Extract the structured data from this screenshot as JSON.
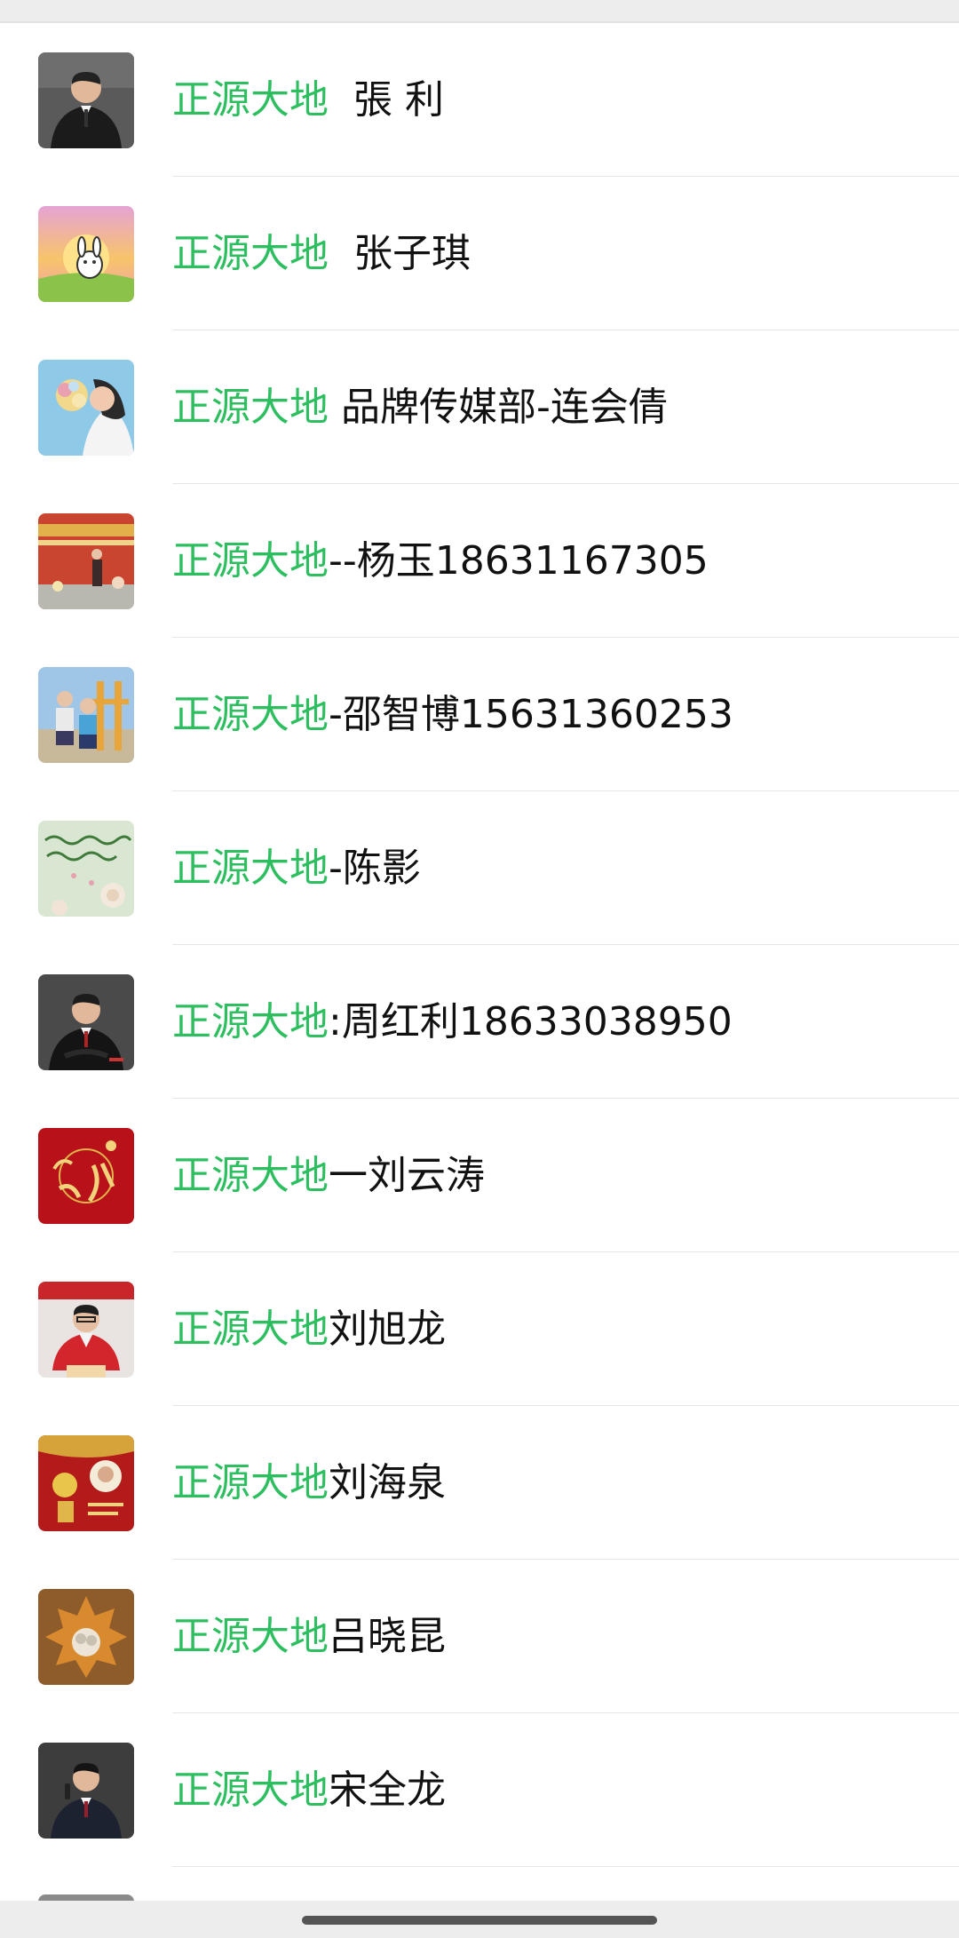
{
  "highlight_color": "#2dbf5f",
  "contacts": [
    {
      "highlight": "正源大地",
      "rest": "  張 利",
      "avatar_icon": "man-in-suit-photo"
    },
    {
      "highlight": "正源大地",
      "rest": "  张子琪",
      "avatar_icon": "cartoon-sunset-avatar"
    },
    {
      "highlight": "正源大地",
      "rest": " 品牌传媒部-连会倩",
      "avatar_icon": "woman-with-flowers-photo"
    },
    {
      "highlight": "正源大地",
      "rest": "--杨玉18631167305",
      "avatar_icon": "red-banner-photo"
    },
    {
      "highlight": "正源大地",
      "rest": "-邵智博15631360253",
      "avatar_icon": "children-playground-photo"
    },
    {
      "highlight": "正源大地",
      "rest": "-陈影",
      "avatar_icon": "flower-calligraphy-avatar"
    },
    {
      "highlight": "正源大地",
      "rest": ":周红利18633038950",
      "avatar_icon": "man-in-suit-photo"
    },
    {
      "highlight": "正源大地",
      "rest": "一刘云涛",
      "avatar_icon": "red-new-year-avatar"
    },
    {
      "highlight": "正源大地",
      "rest": "刘旭龙",
      "avatar_icon": "man-red-jacket-photo"
    },
    {
      "highlight": "正源大地",
      "rest": "刘海泉",
      "avatar_icon": "red-festive-avatar"
    },
    {
      "highlight": "正源大地",
      "rest": "吕晓昆",
      "avatar_icon": "autumn-leaf-avatar"
    },
    {
      "highlight": "正源大地",
      "rest": "宋全龙",
      "avatar_icon": "man-with-mic-photo"
    }
  ]
}
